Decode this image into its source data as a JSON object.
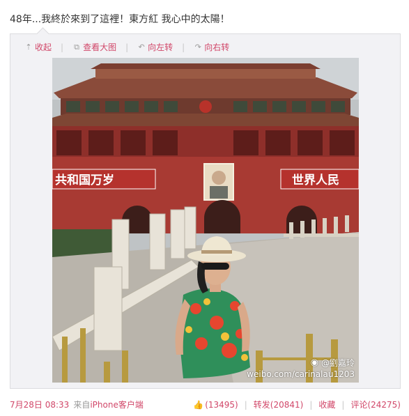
{
  "post": {
    "text": "48年...我終於來到了這裡！東方紅 我心中的太陽！"
  },
  "toolbar": {
    "collapse": {
      "label": "收起",
      "icon": "arrow-up-icon"
    },
    "view_large": {
      "label": "查看大图",
      "icon": "external-view-icon"
    },
    "rotate_left": {
      "label": "向左转",
      "icon": "rotate-left-icon"
    },
    "rotate_right": {
      "label": "向右转",
      "icon": "rotate-right-icon"
    }
  },
  "photo": {
    "banner_left": "共和国万岁",
    "banner_right": "世界人民",
    "watermark_user": "@劉嘉玲",
    "watermark_url": "weibo.com/carinalau1203"
  },
  "footer": {
    "timestamp": "7月28日 08:33",
    "source_prefix": "来自",
    "source_link": "iPhone客户端",
    "like_count": "(13495)",
    "repost_label": "转发(20841)",
    "favorite_label": "收藏",
    "comment_label": "评论(24275)"
  },
  "colors": {
    "link": "#d14769",
    "meta": "#999999",
    "box_bg": "#f2f2f5"
  }
}
